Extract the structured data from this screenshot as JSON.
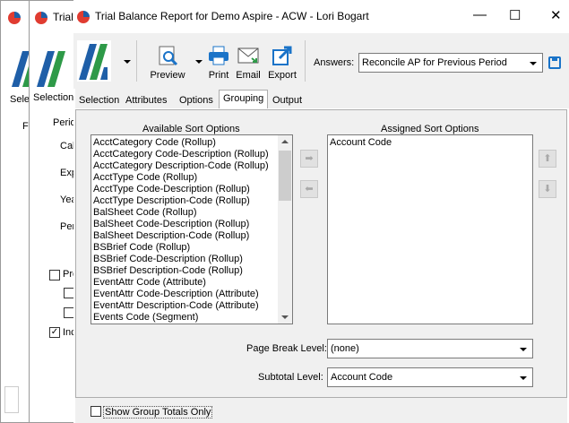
{
  "window": {
    "title": "Trial Balance Report for Demo Aspire - ACW - Lori Bogart",
    "minimize": "—",
    "maximize": "☐",
    "close": "✕"
  },
  "background_windows": {
    "title1": "Trial",
    "title2": "Trial",
    "tab1": "Sele",
    "tab2": "Selection",
    "frame_letter": "F",
    "group_label": "Perio",
    "fields": [
      "Calc",
      "Exp",
      "Year",
      "Per"
    ],
    "check1": "Pro",
    "check2": "Inc"
  },
  "toolbar": {
    "preview_label": "Preview",
    "print_label": "Print",
    "email_label": "Email",
    "export_label": "Export",
    "answers_label": "Answers:",
    "answers_value": "Reconcile AP for Previous Period"
  },
  "tabs": [
    "Selection",
    "Attributes",
    "Options",
    "Grouping",
    "Output"
  ],
  "active_tab": "Grouping",
  "grouping": {
    "available_title": "Available Sort Options",
    "assigned_title": "Assigned Sort Options",
    "available_items": [
      "AcctCategory Code (Rollup)",
      "AcctCategory Code-Description (Rollup)",
      "AcctCategory Description-Code (Rollup)",
      "AcctType Code (Rollup)",
      "AcctType Code-Description (Rollup)",
      "AcctType Description-Code (Rollup)",
      "BalSheet Code (Rollup)",
      "BalSheet Code-Description (Rollup)",
      "BalSheet Description-Code (Rollup)",
      "BSBrief Code (Rollup)",
      "BSBrief Code-Description (Rollup)",
      "BSBrief Description-Code (Rollup)",
      "EventAttr Code (Attribute)",
      "EventAttr Code-Description (Attribute)",
      "EventAttr Description-Code (Attribute)",
      "Events Code (Segment)"
    ],
    "assigned_items": [
      "Account Code"
    ],
    "page_break_label": "Page Break Level:",
    "page_break_value": "(none)",
    "subtotal_label": "Subtotal Level:",
    "subtotal_value": "Account Code",
    "show_totals_label": "Show Group Totals Only"
  },
  "colors": {
    "accent": "#1f5fa8",
    "logo_green": "#2e9a48",
    "button_blue": "#1a73c8"
  }
}
